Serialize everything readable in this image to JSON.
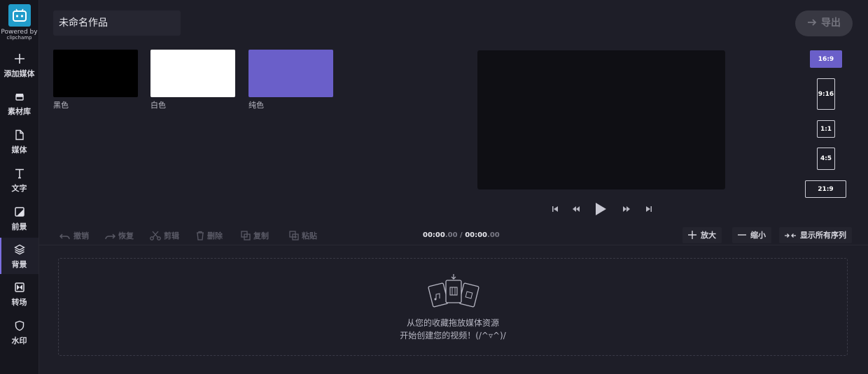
{
  "app": {
    "powered_line1": "Powered by",
    "powered_line2": "clipchamp"
  },
  "sidebar": {
    "items": [
      {
        "label": "添加媒体",
        "icon": "plus-icon"
      },
      {
        "label": "素材库",
        "icon": "library-icon"
      },
      {
        "label": "媒体",
        "icon": "file-icon"
      },
      {
        "label": "文字",
        "icon": "text-icon"
      },
      {
        "label": "前景",
        "icon": "overlay-icon"
      },
      {
        "label": "背景",
        "icon": "layers-icon",
        "active": true
      },
      {
        "label": "转场",
        "icon": "transition-icon"
      },
      {
        "label": "水印",
        "icon": "shield-icon"
      }
    ]
  },
  "header": {
    "project_title": "未命名作品",
    "export_label": "导出"
  },
  "backgrounds": [
    {
      "label": "黑色",
      "color": "#000000"
    },
    {
      "label": "白色",
      "color": "#ffffff"
    },
    {
      "label": "纯色",
      "color": "#6a5fc9"
    }
  ],
  "aspect_ratios": [
    {
      "label": "16:9",
      "active": true
    },
    {
      "label": "9:16"
    },
    {
      "label": "1:1"
    },
    {
      "label": "4:5"
    },
    {
      "label": "21:9"
    }
  ],
  "toolbar": {
    "undo": "撤销",
    "redo": "恢复",
    "cut": "剪辑",
    "delete": "删除",
    "copy": "复制",
    "paste": "粘贴",
    "time_current_main": "00:00",
    "time_current_frac": ".00",
    "time_sep": " / ",
    "time_total_main": "00:00",
    "time_total_frac": ".00",
    "zoom_in": "放大",
    "zoom_out": "缩小",
    "show_all": "显示所有序列"
  },
  "dropzone": {
    "line1": "从您的收藏拖放媒体资源",
    "line2": "开始创建您的视频！(/^▿^)/"
  },
  "colors": {
    "accent": "#6a5fc9",
    "logo": "#219cca"
  }
}
